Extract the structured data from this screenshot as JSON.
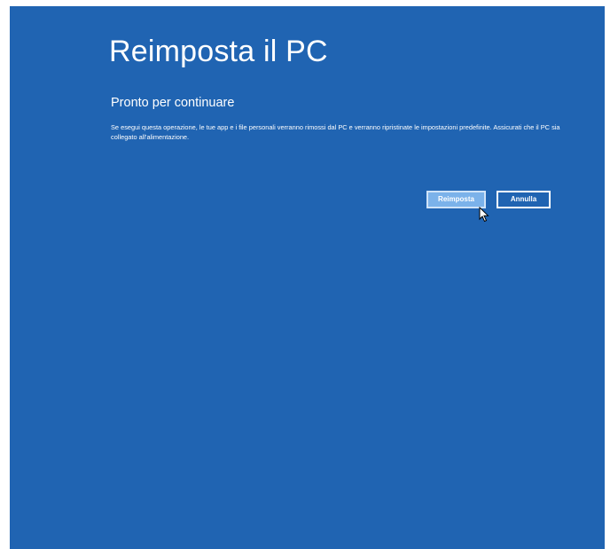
{
  "page": {
    "title": "Reimposta il PC",
    "subtitle": "Pronto per continuare",
    "description": "Se esegui questa operazione, le tue app e i file personali verranno rimossi dal PC e verranno ripristinate le impostazioni predefinite. Assicurati che il PC sia collegato all'alimentazione."
  },
  "buttons": {
    "reset_label": "Reimposta",
    "cancel_label": "Annulla"
  },
  "colors": {
    "background": "#2064b2",
    "primary_button": "#7bb2ea",
    "text": "#ffffff"
  },
  "icons": {
    "cursor": "mouse-pointer-arrow"
  }
}
